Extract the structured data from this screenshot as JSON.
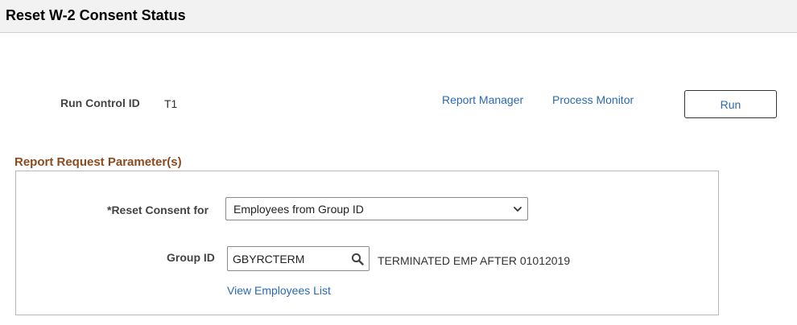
{
  "page": {
    "title": "Reset W-2 Consent Status"
  },
  "run_control": {
    "label": "Run Control ID",
    "value": "T1"
  },
  "links": {
    "report_manager": "Report Manager",
    "process_monitor": "Process Monitor",
    "view_employees": "View Employees List"
  },
  "actions": {
    "run_label": "Run"
  },
  "section": {
    "title": "Report Request Parameter(s)"
  },
  "reset_consent": {
    "label": "*Reset Consent for",
    "selected": "Employees from Group ID"
  },
  "group_id": {
    "label": "Group ID",
    "value": "GBYRCTERM",
    "description": "TERMINATED EMP AFTER 01012019"
  },
  "icons": {
    "dropdown": "chevron-down-icon",
    "lookup": "search-icon"
  },
  "colors": {
    "link": "#2a69b3",
    "section_title": "#8c4b1f",
    "title_bar": "#f2f2f2"
  }
}
